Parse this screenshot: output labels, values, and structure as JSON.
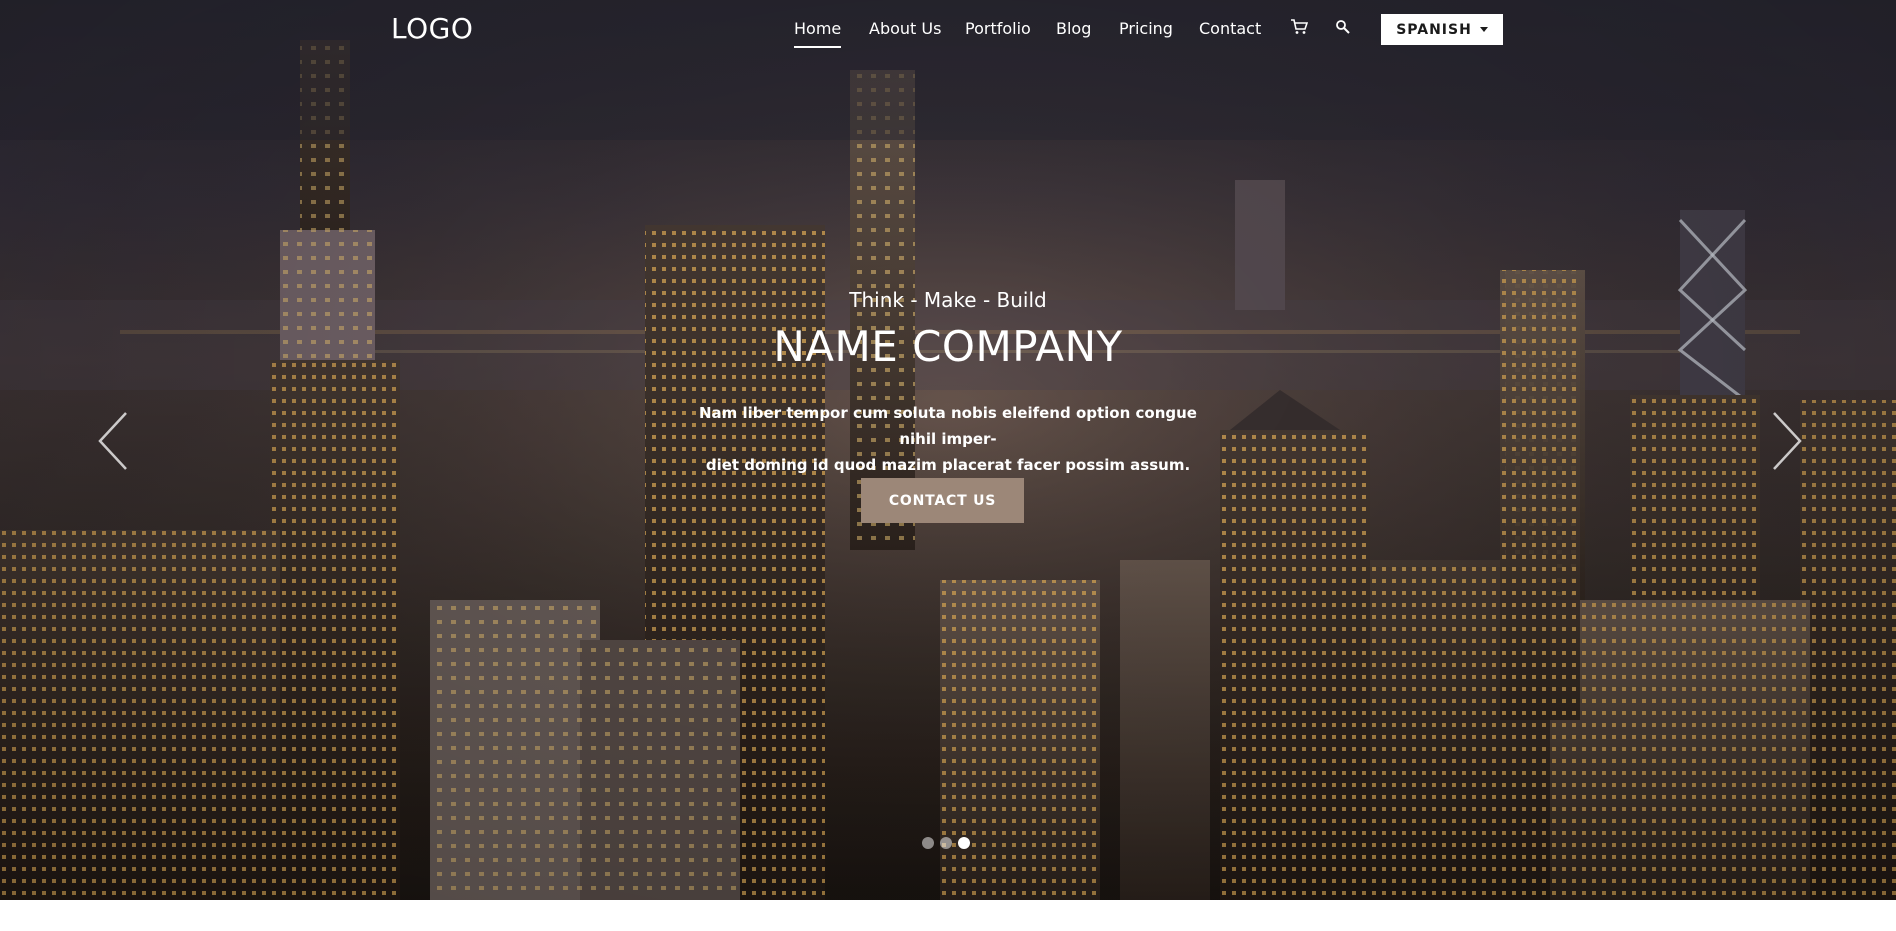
{
  "navbar": {
    "logo": "LOGO",
    "items": [
      {
        "label": "Home",
        "active": true
      },
      {
        "label": "About Us"
      },
      {
        "label": "Portfolio"
      },
      {
        "label": "Blog"
      },
      {
        "label": "Pricing"
      },
      {
        "label": "Contact"
      }
    ],
    "icons": [
      "cart-icon",
      "search-icon"
    ],
    "language_label": "SPANISH"
  },
  "hero": {
    "tagline": "Think - Make - Build",
    "title": "NAME COMPANY",
    "description_line1": "Nam liber tempor cum soluta nobis eleifend option congue nihil imper-",
    "description_line2": "diet doming id quod mazim placerat facer possim assum.",
    "cta_label": "CONTACT US"
  },
  "carousel": {
    "slide_count": 3,
    "active_slide": 3
  },
  "colors": {
    "cta_background": "#9c8778",
    "language_button_background": "#ffffff",
    "text": "#ffffff"
  }
}
